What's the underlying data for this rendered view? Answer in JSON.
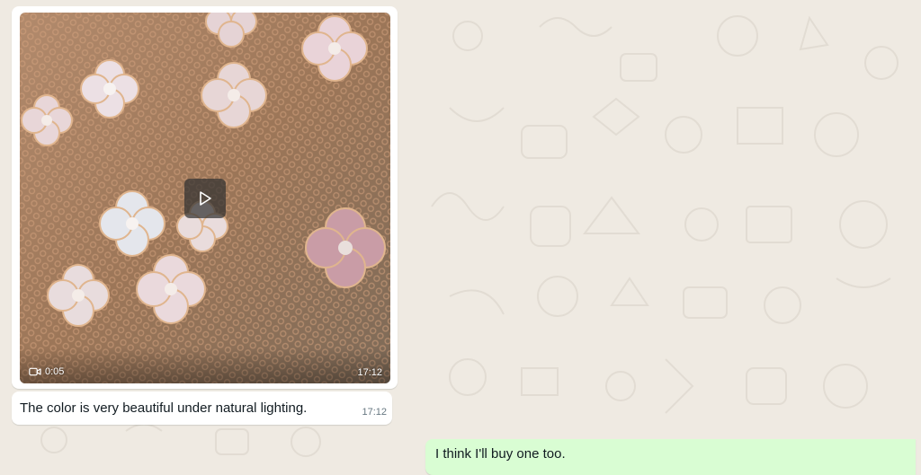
{
  "chat": {
    "background_color": "#efeae2",
    "incoming_bg": "#ffffff",
    "outgoing_bg": "#d9fdd3"
  },
  "messages": [
    {
      "type": "video",
      "direction": "incoming",
      "duration": "0:05",
      "time": "17:12",
      "play_icon": "play-icon",
      "video_icon": "video-camera-icon"
    },
    {
      "type": "text",
      "direction": "incoming",
      "text": "The color is very beautiful under natural lighting.",
      "time": "17:12"
    },
    {
      "type": "text",
      "direction": "outgoing",
      "text": "I think I'll buy one too."
    }
  ]
}
